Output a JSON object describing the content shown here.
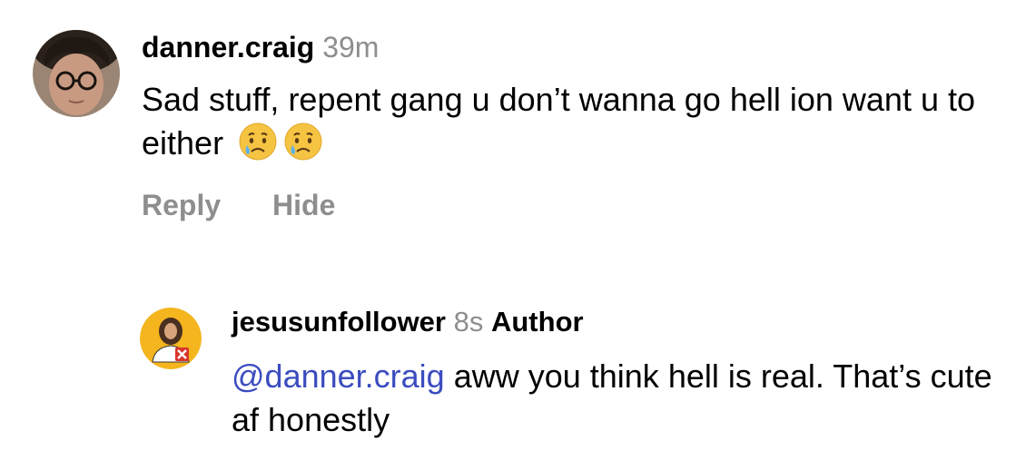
{
  "comments": [
    {
      "username": "danner.craig",
      "time": "39m",
      "text": "Sad stuff, repent gang u don’t wanna go hell ion want u to either",
      "emojis": [
        "crying-face-emoji",
        "crying-face-emoji"
      ],
      "actions": [
        "Reply",
        "Hide"
      ]
    },
    {
      "username": "jesusunfollower",
      "time": "8s",
      "badge": "Author",
      "mention": "@danner.craig",
      "text": "aww you think hell is real. That’s cute af honestly"
    }
  ],
  "colors": {
    "timestamp": "#8e8e8e",
    "mention": "#3b4cc0",
    "author_avatar_bg": "#f4b51e"
  }
}
